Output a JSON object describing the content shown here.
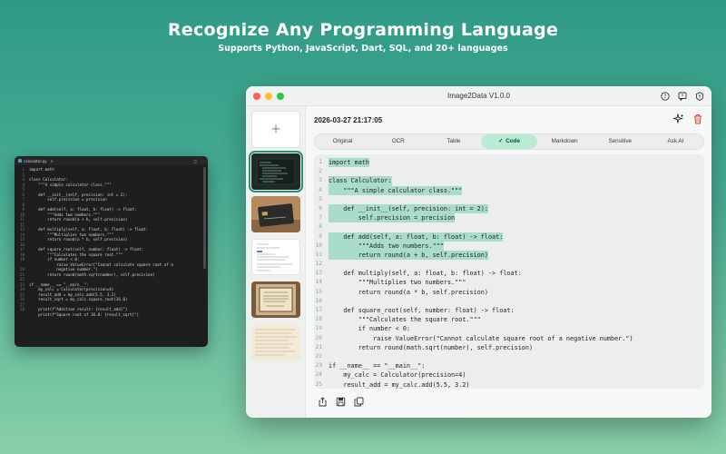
{
  "hero": {
    "title": "Recognize Any Programming Language",
    "subtitle": "Supports Python, JavaScript, Dart, SQL, and 20+ languages"
  },
  "editor": {
    "tab_name": "calculator.py",
    "lines": [
      "import math",
      "",
      "class Calculator:",
      "    \"\"\"A simple calculator class.\"\"\"",
      "",
      "    def __init__(self, precision: int = 2):",
      "        self.precision = precision",
      "",
      "    def add(self, a: float, b: float) -> float:",
      "        \"\"\"Adds two numbers.\"\"\"",
      "        return round(a + b, self.precision)",
      "",
      "    def multiply(self, a: float, b: float) -> float:",
      "        \"\"\"Multiplies two numbers.\"\"\"",
      "        return round(a * b, self.precision)",
      "",
      "    def square_root(self, number: float) -> float:",
      "        \"\"\"Calculates the square root.\"\"\"",
      "        if number < 0:",
      "            raise ValueError(\"Cannot calculate square root of a",
      "            negative number.\")",
      "        return round(math.sqrt(number), self.precision)",
      "",
      "if __name__ == \"__main__\":",
      "    my_calc = Calculator(precision=4)",
      "    result_add = my_calc.add(5.5, 3.2)",
      "    result_sqrt = my_calc.square_root(16.0)",
      "",
      "    print(f\"Addition result: {result_add}\")",
      "    print(f\"Square root of 16.0: {result_sqrt}\")"
    ],
    "line_numbers": [
      "1",
      "2",
      "3",
      "4",
      "5",
      "6",
      "7",
      "8",
      "9",
      "10",
      "11",
      "12",
      "13",
      "14",
      "15",
      "16",
      "17",
      "18",
      "19",
      "",
      "20",
      "21",
      "22",
      "23",
      "24",
      "25",
      "26",
      "27",
      "28"
    ]
  },
  "window": {
    "title": "Image2Data V1.0.0",
    "icons": [
      "help-icon",
      "feedback-icon",
      "info-icon"
    ]
  },
  "sidebar": {
    "add_label": "+",
    "thumbnails": [
      "code-screenshot",
      "credit-card-photo",
      "document-scan",
      "certificate-photo",
      "handwritten-note"
    ]
  },
  "main": {
    "datetime": "2026-03-27 21:17:05",
    "tabs": [
      "Original",
      "OCR",
      "Table",
      "Code",
      "Markdown",
      "Sensitive",
      "Ask AI"
    ],
    "active_tab": "Code",
    "active_tab_check": "✓"
  },
  "code": {
    "line_numbers": [
      "1",
      "2",
      "3",
      "4",
      "5",
      "6",
      "7",
      "8",
      "9",
      "10",
      "11",
      "12",
      "13",
      "14",
      "15",
      "16",
      "17",
      "18",
      "19",
      "20",
      "21",
      "22",
      "23",
      "24",
      "25"
    ],
    "lines": [
      "import math",
      "",
      "class Calculator:",
      "    \"\"\"A simple calculator class.\"\"\"",
      "",
      "    def __init__(self, precision: int = 2):",
      "        self.precision = precision",
      "",
      "    def add(self, a: float, b: float) -> float:",
      "        \"\"\"Adds two numbers.\"\"\"",
      "        return round(a + b, self.precision)",
      "",
      "    def multiply(self, a: float, b: float) -> float:",
      "        \"\"\"Multiplies two numbers.\"\"\"",
      "        return round(a * b, self.precision)",
      "",
      "    def square_root(self, number: float) -> float:",
      "        \"\"\"Calculates the square root.\"\"\"",
      "        if number < 0:",
      "            raise ValueError(\"Cannot calculate square root of a negative number.\")",
      "        return round(math.sqrt(number), self.precision)",
      "",
      "if __name__ == \"__main__\":",
      "    my_calc = Calculator(precision=4)",
      "    result_add = my_calc.add(5.5, 3.2)"
    ],
    "highlighted": [
      1,
      3,
      4,
      6,
      7,
      9,
      10,
      11
    ]
  },
  "colors": {
    "accent": "#2e8f6c",
    "active_tab_bg": "#b9ecd3",
    "highlight": "#a9dccd",
    "delete": "#e0453a"
  },
  "bottom_actions": [
    "share-icon",
    "save-icon",
    "copy-icon"
  ]
}
